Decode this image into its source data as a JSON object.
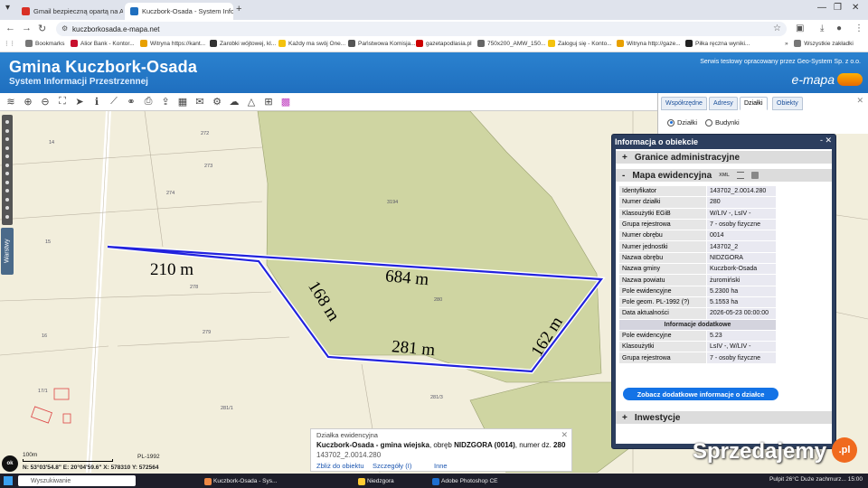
{
  "browser": {
    "tabs": [
      {
        "label": "Gmail bezpieczną opartą na AI",
        "color": "#d93025"
      },
      {
        "label": "Kuczbork-Osada - System Infor",
        "color": "#1f6fbf"
      }
    ],
    "url": "kuczborkosada.e-mapa.net",
    "bookmarks": [
      {
        "label": "Bookmarks",
        "color": "#777"
      },
      {
        "label": "Alior Bank - Kontor...",
        "color": "#c8102e"
      },
      {
        "label": "Witryna https://kant...",
        "color": "#e8a000"
      },
      {
        "label": "Zarobki wójtowej, kl...",
        "color": "#333"
      },
      {
        "label": "Każdy ma swój One...",
        "color": "#f4c20d"
      },
      {
        "label": "Państwowa Komisja...",
        "color": "#555"
      },
      {
        "label": "gazetapodlasia.pl",
        "color": "#c00"
      },
      {
        "label": "750x200_AMW_150...",
        "color": "#666"
      },
      {
        "label": "Zaloguj się - Konto...",
        "color": "#f4c20d"
      },
      {
        "label": "Witryna http://gaze...",
        "color": "#e8a000"
      },
      {
        "label": "Piłka ręczna wyniki...",
        "color": "#222"
      },
      {
        "label": "Wszystkie zakładki",
        "color": "#777"
      }
    ]
  },
  "header": {
    "title": "Gmina Kuczbork-Osada",
    "subtitle": "System Informacji Przestrzennej",
    "server_note": "Serwis testowy opracowany przez Geo-System Sp. z o.o.",
    "logo": "e-mapa"
  },
  "toolbar": {
    "icons": [
      "layers-icon",
      "zoom-in-icon",
      "zoom-out-icon",
      "zoom-extent-icon",
      "pointer-icon",
      "info-icon",
      "measure-icon",
      "link-icon",
      "print-icon",
      "export-icon",
      "layout-icon",
      "comment-icon",
      "settings-icon",
      "upload-icon",
      "triangle-icon",
      "grid-icon",
      "color-icon"
    ]
  },
  "search_panel": {
    "tabs": [
      "Współrzędne",
      "Adresy",
      "Działki",
      "Obiekty"
    ],
    "active_tab": "Działki",
    "radio_options": [
      "Działki",
      "Budynki"
    ],
    "selected_radio": "Działki"
  },
  "info_panel": {
    "title": "Informacja o obiekcie",
    "controls": "- ✕",
    "sections": {
      "granice": "Granice administracyjne",
      "mapa": "Mapa ewidencyjna",
      "mapa_xml": "XML",
      "inwestycje": "Inwestycje"
    },
    "attributes": [
      {
        "k": "Identyfikator",
        "v": "143702_2.0014.280"
      },
      {
        "k": "Numer działki",
        "v": "280"
      },
      {
        "k": "Klasoużytki EGiB",
        "v": "W/LIV -, LsIV -"
      },
      {
        "k": "Grupa rejestrowa",
        "v": "7 - osoby fizyczne"
      },
      {
        "k": "Numer obrębu",
        "v": "0014"
      },
      {
        "k": "Numer jednostki",
        "v": "143702_2"
      },
      {
        "k": "Nazwa obrębu",
        "v": "NIDZGORA"
      },
      {
        "k": "Nazwa gminy",
        "v": "Kuczbork-Osada"
      },
      {
        "k": "Nazwa powiatu",
        "v": "żuromiński"
      },
      {
        "k": "Pole ewidencyjne",
        "v": "5.2300 ha"
      },
      {
        "k": "Pole geom. PL-1992 (?)",
        "v": "5.1553 ha"
      },
      {
        "k": "Data aktualności",
        "v": "2026-05-23 00:00:00"
      }
    ],
    "extra_header": "Informacje dodatkowe",
    "extra_attributes": [
      {
        "k": "Pole ewidencyjne",
        "v": "5.23"
      },
      {
        "k": "Klasoużytki",
        "v": "LsIV -, W/LIV -"
      },
      {
        "k": "Grupa rejestrowa",
        "v": "7 - osoby fizyczne"
      }
    ],
    "more_button": "Zobacz dodatkowe informacje o działce"
  },
  "map": {
    "parcel_labels": [
      "14",
      "272",
      "273",
      "274",
      "3194",
      "15",
      "278",
      "280",
      "279",
      "16",
      "17/1",
      "281/3",
      "281/1"
    ],
    "dimensions": [
      "210 m",
      "684 m",
      "168 m",
      "281 m",
      "162 m"
    ],
    "highlight_color": "#2222dd",
    "forest_color": "#cfd5a2",
    "warstwy": "Warstwy"
  },
  "popup": {
    "header": "Działka ewidencyjna",
    "gmina": "Kuczbork-Osada - gmina wiejska",
    "line_rest_1": ", obręb ",
    "obreb": "NIDZGORA (0014)",
    "line_rest_2": ", numer dz.",
    "numer": "280",
    "identifier": "143702_2.0014.280",
    "links": [
      "Zbliż do obiektu",
      "Szczegóły (I)",
      "Inne"
    ]
  },
  "status": {
    "ok": "ok",
    "scale": "100m",
    "crs": "PL-1992",
    "coords": "N: 53°03'54.8\"  E: 20°04'59.6\"   X: 578310    Y: 572564"
  },
  "watermark": {
    "text": "Sprzedajemy",
    "suffix": ".pl"
  },
  "taskbar": {
    "search": "Wyszukiwanie",
    "apps": [
      "Kuczbork-Osada - Sys...",
      "Niedzgora",
      "Adobe Photoshop CE"
    ],
    "tray": "Pulpit   26°C  Duże zachmurz...   15:00"
  }
}
